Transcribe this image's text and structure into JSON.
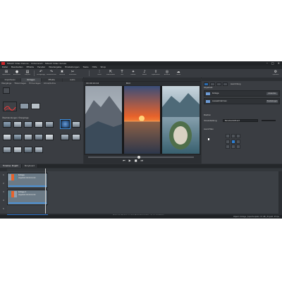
{
  "app": {
    "title": "MAGIX Video Deluxe – Unbenannt – MAGIX Video deluxe",
    "window_buttons": [
      "–",
      "□",
      "✕"
    ]
  },
  "menu": [
    "Datei",
    "Bearbeiten",
    "Effekte",
    "Fenster",
    "Wiedergabe",
    "Einstellungen",
    "Tasks",
    "Hilfe",
    "Shop"
  ],
  "toolbar": {
    "buttons": [
      {
        "icon": "import-icon",
        "glyph": "⊞",
        "label": "Importieren"
      },
      {
        "icon": "record-icon",
        "glyph": "●",
        "label": "Aufnahme"
      },
      {
        "icon": "folder-icon",
        "glyph": "▤",
        "label": "Projekte"
      },
      {
        "icon": "undo-icon",
        "glyph": "↶",
        "label": "Rückgängig"
      },
      {
        "icon": "redo-icon",
        "glyph": "↷",
        "label": "Wiederherstellen"
      },
      {
        "icon": "delete-icon",
        "glyph": "✖",
        "label": "Löschen"
      },
      {
        "icon": "cut-icon",
        "glyph": "✂",
        "label": "Schneiden"
      },
      {
        "icon": "split-icon",
        "glyph": "⫶",
        "label": "Teilen"
      },
      {
        "icon": "mouse-mode-icon",
        "glyph": "⇱",
        "label": "Mausmodus"
      },
      {
        "icon": "title-icon",
        "glyph": "T",
        "label": "Titel"
      },
      {
        "icon": "effects-icon",
        "glyph": "✦",
        "label": "Effekte"
      },
      {
        "icon": "audio-icon",
        "glyph": "♪",
        "label": "Audio"
      },
      {
        "icon": "export-icon",
        "glyph": "⇪",
        "label": "Exportieren"
      },
      {
        "icon": "burn-icon",
        "glyph": "◎",
        "label": "Brennen"
      },
      {
        "icon": "online-icon",
        "glyph": "☁",
        "label": "Online"
      },
      {
        "icon": "settings-icon",
        "glyph": "⚙",
        "label": "Optionen"
      }
    ]
  },
  "left_panel": {
    "tabs": [
      "Importieren",
      "Vorlagen",
      "Effekte",
      "Audio"
    ],
    "active_tab": 1,
    "subtabs": [
      "Übergänge",
      "Titelvorlagen",
      "Filmvorlagen",
      "Intros/Outros"
    ],
    "section_label": "Überblendungen: Übergänge",
    "colors": {
      "accent": "#3d8fe0"
    }
  },
  "preview": {
    "header": "Programmmonitor",
    "timecode": "00:00:14:12",
    "zoom": "Bild",
    "colors": {
      "sunset": "#e8622b",
      "sky": "#5a7fb0"
    }
  },
  "right_panel": {
    "header": "Objektstil",
    "tab_label": "Ausrichtung",
    "items": [
      {
        "title": "Kollage",
        "button": "Anwenden"
      },
      {
        "title": "Auswahlrahmen",
        "button": "Einstellungen"
      }
    ],
    "section_position": "Position",
    "section_align": "Ausrichten",
    "preset_label": "Voreinstellung",
    "preset_value": "Benutzerdefiniert",
    "grid_active": 4
  },
  "timeline": {
    "tabs": [
      "Timeline: Projekt",
      "Storyboard"
    ],
    "active_tab": 0,
    "tracks": [
      "1",
      "2",
      "3",
      "4",
      "5"
    ],
    "clips": [
      {
        "title": "Kollage",
        "subtitle": "Objektstil 00:00:10:00"
      },
      {
        "title": "Kollage 2",
        "subtitle": "Objektstil 00:00:10:00"
      }
    ],
    "hint": "Ziehen Sie Medien aus dem Media Pool hierhin, um sie einzufügen"
  },
  "status": "Objekt: Kollage   |   Speicherplatz: 15 GB   |   Projekt: 25 fps"
}
